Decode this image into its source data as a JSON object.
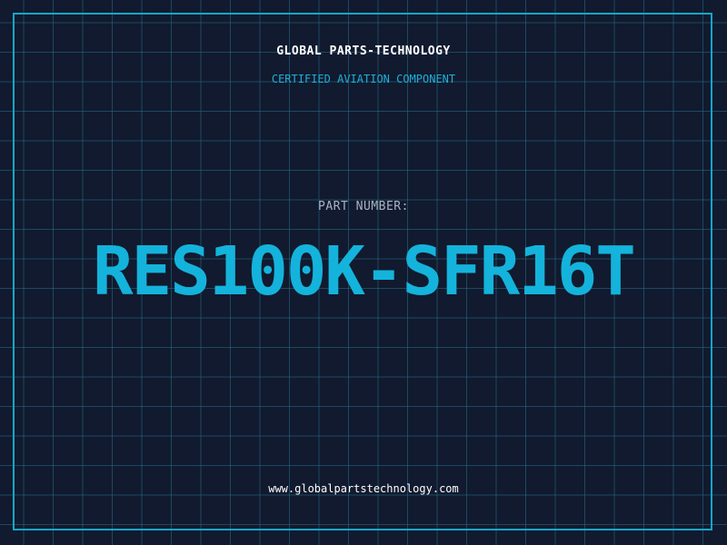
{
  "header": {
    "company": "GLOBAL PARTS-TECHNOLOGY",
    "subtitle": "CERTIFIED AVIATION COMPONENT"
  },
  "part": {
    "label": "PART NUMBER:",
    "number": "RES100K-SFR16T"
  },
  "footer": {
    "url": "www.globalpartstechnology.com"
  },
  "colors": {
    "background": "#111a2e",
    "grid": "#286e8c",
    "accent": "#14b3dc",
    "frame": "#14a6c9",
    "text": "#ffffff",
    "muted": "#a9b3c4"
  }
}
